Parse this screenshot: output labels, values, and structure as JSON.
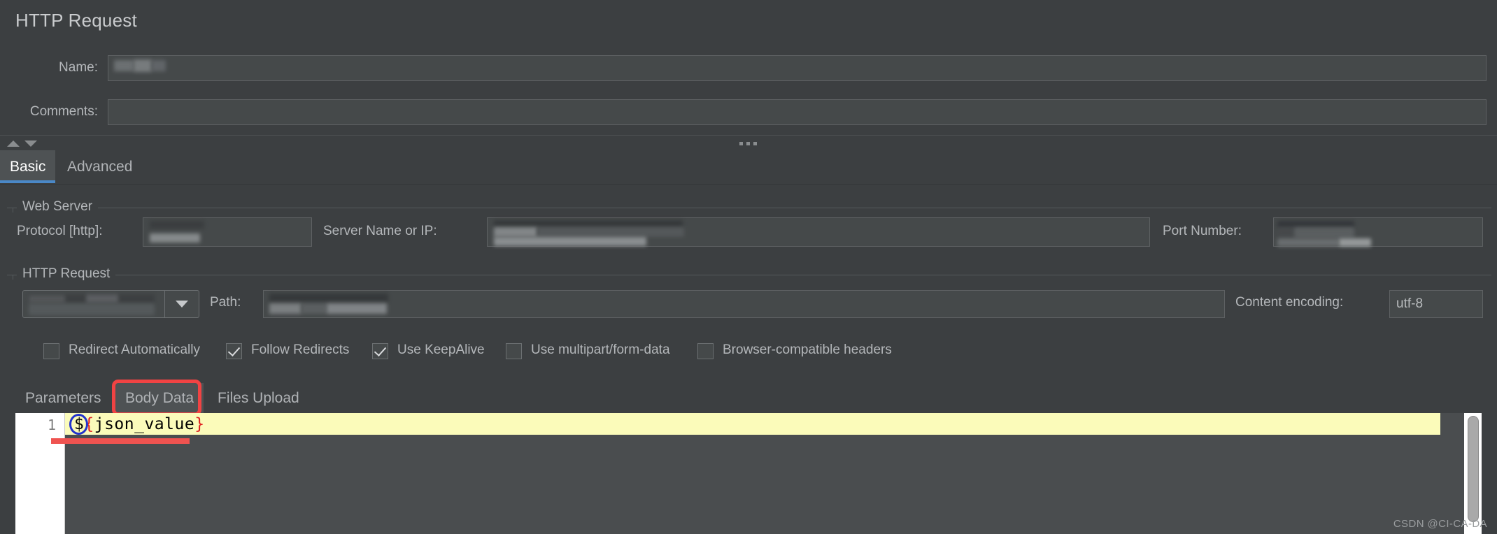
{
  "panel": {
    "title": "HTTP Request"
  },
  "form": {
    "name_label": "Name:",
    "name_value": "",
    "comments_label": "Comments:",
    "comments_value": ""
  },
  "splitter": {
    "expand_icon": "triangle-up-icon",
    "collapse_icon": "triangle-down-icon",
    "grip_icon": "three-dots-icon"
  },
  "main_tabs": [
    {
      "label": "Basic",
      "selected": true
    },
    {
      "label": "Advanced",
      "selected": false
    }
  ],
  "web_server": {
    "legend": "Web Server",
    "protocol_label": "Protocol [http]:",
    "protocol_value": "",
    "server_label": "Server Name or IP:",
    "server_value": "",
    "port_label": "Port Number:",
    "port_value": ""
  },
  "http_request": {
    "legend": "HTTP Request",
    "method_value": "",
    "method_dropdown_icon": "chevron-down-icon",
    "path_label": "Path:",
    "path_value": "",
    "content_encoding_label": "Content encoding:",
    "content_encoding_value": "utf-8",
    "checkboxes": [
      {
        "label": "Redirect Automatically",
        "checked": false
      },
      {
        "label": "Follow Redirects",
        "checked": true
      },
      {
        "label": "Use KeepAlive",
        "checked": true
      },
      {
        "label": "Use multipart/form-data",
        "checked": false
      },
      {
        "label": "Browser-compatible headers",
        "checked": false
      }
    ]
  },
  "sub_tabs": [
    {
      "label": "Parameters",
      "selected": false
    },
    {
      "label": "Body Data",
      "selected": true
    },
    {
      "label": "Files Upload",
      "selected": false
    }
  ],
  "editor": {
    "line_number": "1",
    "tokens": {
      "dollar": "$",
      "open_brace": "{",
      "variable": "json_value",
      "close_brace": "}"
    },
    "full_text": "${json_value}"
  },
  "annotations": {
    "tab_highlight_color": "#f04343",
    "brace_circle_color": "#2233cc",
    "underline_color": "#ef5350"
  },
  "watermark": "CSDN @CI-CA-DA",
  "colors": {
    "background": "#3c3f41",
    "input_background": "#45494a",
    "accent": "#4a88c7",
    "text": "#b4b7ba",
    "editor_line_highlight": "#fbfbba"
  }
}
